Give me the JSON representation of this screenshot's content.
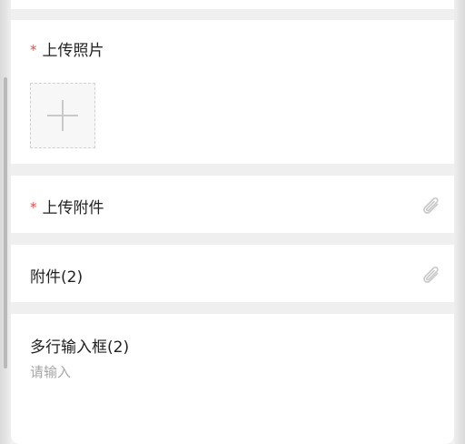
{
  "form": {
    "photo": {
      "required_mark": "*",
      "label": "上传照片",
      "upload_icon": "plus-icon"
    },
    "attachment_required": {
      "required_mark": "*",
      "label": "上传附件",
      "icon": "paperclip-icon"
    },
    "attachment": {
      "label": "附件(2)",
      "icon": "paperclip-icon"
    },
    "multiline": {
      "label": "多行输入框(2)",
      "placeholder": "请输入",
      "value": ""
    }
  },
  "colors": {
    "required": "#e34d4d",
    "background": "#efefef",
    "card": "#ffffff",
    "placeholder": "#a6a6a6",
    "icon": "#c8c8c8"
  }
}
